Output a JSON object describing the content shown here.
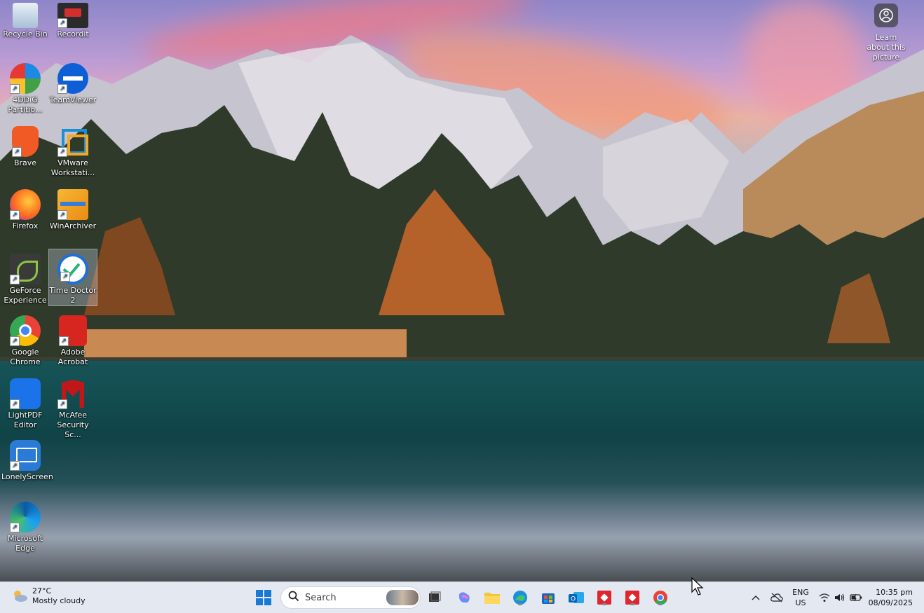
{
  "desktop": {
    "learn_about": "Learn about this picture",
    "icons": [
      {
        "label": "Recycle Bin",
        "icon": "recycle-bin-icon"
      },
      {
        "label": "Recordit",
        "icon": "recordit-icon"
      },
      {
        "label": "4DDiG Partitio...",
        "icon": "4ddig-icon"
      },
      {
        "label": "TeamViewer",
        "icon": "teamviewer-icon"
      },
      {
        "label": "Brave",
        "icon": "brave-icon"
      },
      {
        "label": "VMware Workstati...",
        "icon": "vmware-icon"
      },
      {
        "label": "Firefox",
        "icon": "firefox-icon"
      },
      {
        "label": "WinArchiver",
        "icon": "winarchiver-icon"
      },
      {
        "label": "GeForce Experience",
        "icon": "geforce-icon"
      },
      {
        "label": "Time Doctor 2",
        "icon": "time-doctor-icon"
      },
      {
        "label": "Google Chrome",
        "icon": "chrome-icon"
      },
      {
        "label": "Adobe Acrobat",
        "icon": "acrobat-icon"
      },
      {
        "label": "LightPDF Editor",
        "icon": "lightpdf-icon"
      },
      {
        "label": "McAfee Security Sc...",
        "icon": "mcafee-icon"
      },
      {
        "label": "LonelyScreen",
        "icon": "lonelyscreen-icon"
      },
      {
        "label": "Microsoft Edge",
        "icon": "edge-icon"
      }
    ]
  },
  "taskbar": {
    "weather": {
      "temp": "27°C",
      "condition": "Mostly cloudy"
    },
    "search_placeholder": "Search",
    "language": {
      "line1": "ENG",
      "line2": "US"
    },
    "clock": {
      "time": "10:35 pm",
      "date": "08/09/2025"
    }
  }
}
